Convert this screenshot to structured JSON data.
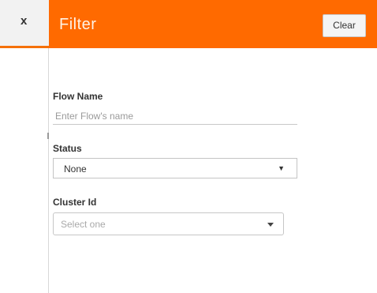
{
  "panel": {
    "close_label": "x",
    "title": "Filter",
    "clear_label": "Clear"
  },
  "form": {
    "flow_name": {
      "label": "Flow Name",
      "placeholder": "Enter Flow's name",
      "value": ""
    },
    "status": {
      "label": "Status",
      "value": "None"
    },
    "cluster_id": {
      "label": "Cluster Id",
      "placeholder": "Select one"
    }
  },
  "colors": {
    "header_bg": "#ff6a00",
    "accent": "#f5700a"
  }
}
